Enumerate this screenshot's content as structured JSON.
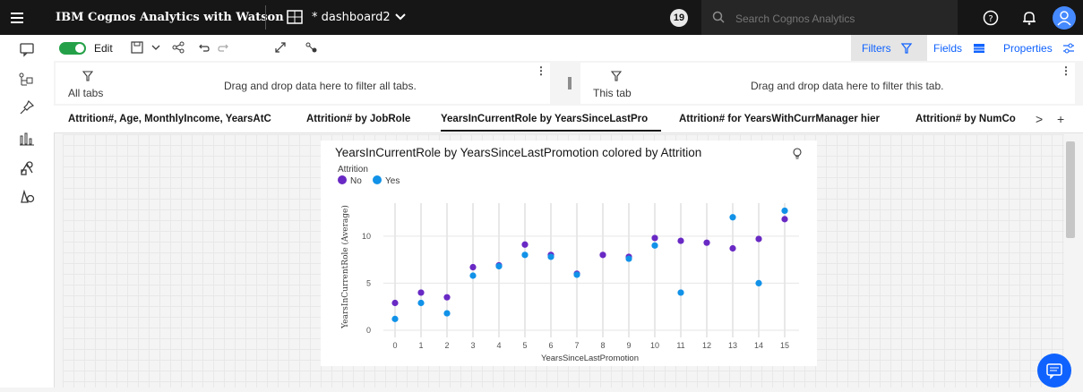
{
  "app": {
    "title": "IBM Cognos Analytics with Watson",
    "dashboard_name": "* dashboard2",
    "notification_count": "19",
    "search_placeholder": "Search Cognos Analytics"
  },
  "toolbar": {
    "edit_label": "Edit",
    "filters_label": "Filters",
    "fields_label": "Fields",
    "properties_label": "Properties"
  },
  "filters": {
    "all_tabs_title": "All tabs",
    "all_tabs_hint": "Drag and drop data here to filter all tabs.",
    "this_tab_title": "This tab",
    "this_tab_hint": "Drag and drop data here to filter this tab.",
    "more": "⋮"
  },
  "tabs": [
    {
      "label": "Attrition#, Age, MonthlyIncome, YearsAtC"
    },
    {
      "label": "Attrition# by JobRole"
    },
    {
      "label": "YearsInCurrentRole by YearsSinceLastPro"
    },
    {
      "label": "Attrition# for YearsWithCurrManager hier"
    },
    {
      "label": "Attrition# by NumCo"
    }
  ],
  "tab_nav": {
    "next": ">",
    "add": "+"
  },
  "colors": {
    "no": "#6929c4",
    "yes": "#1192e8",
    "accent": "#0f62fe"
  },
  "chart_data": {
    "type": "scatter",
    "title": "YearsInCurrentRole by YearsSinceLastPromotion colored by Attrition",
    "legend_title": "Attrition",
    "legend_position": "top-left",
    "xlabel": "YearsSinceLastPromotion",
    "ylabel": "YearsInCurrentRole (Average)",
    "x": [
      0,
      1,
      2,
      3,
      4,
      5,
      6,
      7,
      8,
      9,
      10,
      11,
      12,
      13,
      14,
      15
    ],
    "ylim": [
      0,
      13.5
    ],
    "yticks": [
      0,
      5,
      10
    ],
    "grid": "vertical",
    "series": [
      {
        "name": "No",
        "color": "#6929c4",
        "values": [
          2.9,
          4.0,
          3.5,
          6.7,
          6.9,
          9.1,
          8.0,
          6.0,
          8.0,
          7.8,
          9.8,
          9.5,
          9.3,
          8.7,
          9.7,
          11.8
        ]
      },
      {
        "name": "Yes",
        "color": "#1192e8",
        "values": [
          1.2,
          2.9,
          1.8,
          5.8,
          6.8,
          8.0,
          7.8,
          5.9,
          null,
          7.6,
          9.0,
          4.0,
          null,
          12.0,
          5.0,
          12.7
        ]
      }
    ]
  }
}
